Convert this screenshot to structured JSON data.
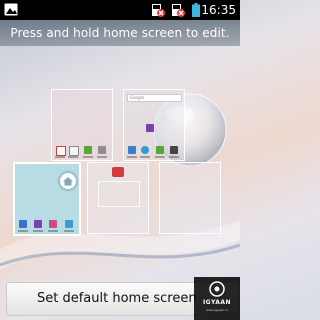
{
  "status_bar": {
    "time": "16:35",
    "icons": [
      "gallery-icon",
      "usb-debug-icon",
      "sim-missing-icon",
      "battery-icon"
    ]
  },
  "instruction": "Press and hold home screen to edit.",
  "screens": [
    {
      "name": "screen-1",
      "icons": [
        "calendar-icon",
        "calendar-date-icon",
        "play-store-icon",
        "settings-icon"
      ]
    },
    {
      "name": "screen-2",
      "search_placeholder": "Google",
      "icons": [
        "app-icon",
        "people-icon",
        "browser-icon",
        "play-store-icon",
        "app-icon"
      ]
    },
    {
      "name": "screen-3",
      "is_home": true,
      "icons": [
        "app-icon",
        "app-icon",
        "app-icon",
        "app-icon"
      ]
    },
    {
      "name": "screen-4",
      "icons": [
        "widget-icon"
      ]
    },
    {
      "name": "screen-5",
      "icons": []
    }
  ],
  "default_button": "Set default home screen",
  "watermark": {
    "brand": "IGYAAN",
    "url": "www.igyaan.in"
  },
  "colors": {
    "status_bar": "#000000",
    "home_screen_highlight": "#b9dbe3",
    "button_bg": "#efefef"
  }
}
